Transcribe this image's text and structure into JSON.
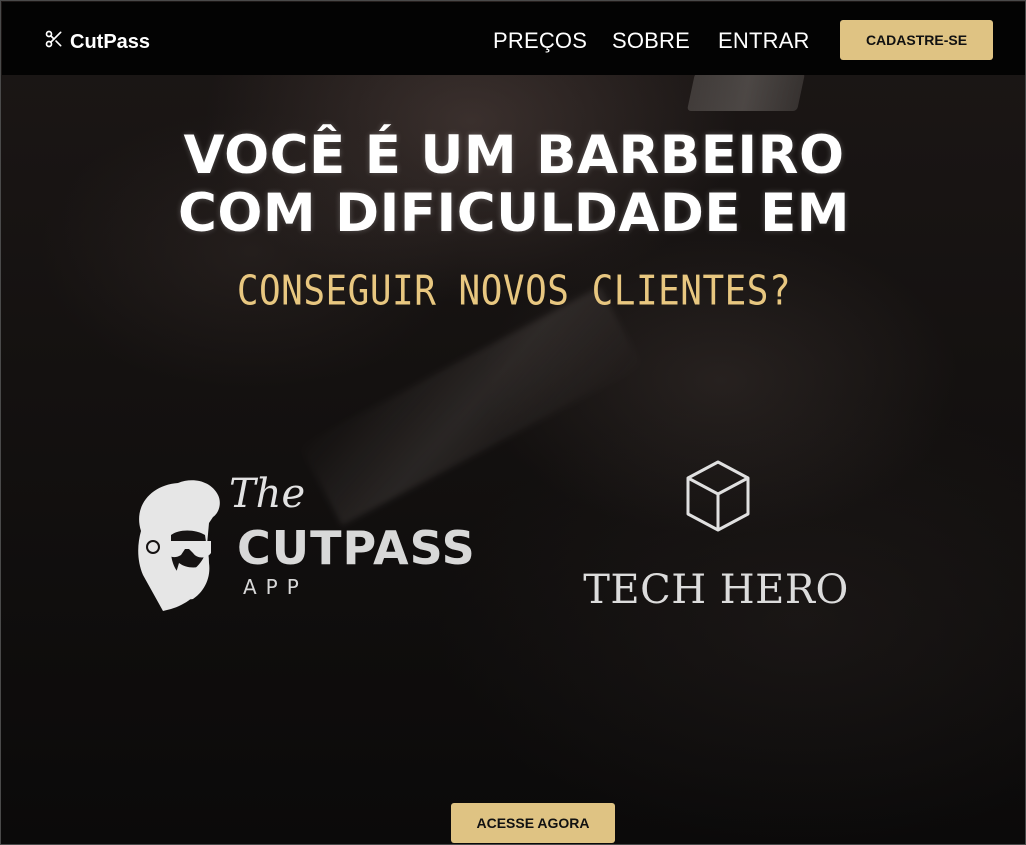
{
  "header": {
    "brand_name": "CutPass",
    "brand_icon": "scissors-icon",
    "nav": {
      "pricing": "PREÇOS",
      "about": "SOBRE",
      "login": "ENTRAR"
    },
    "signup_label": "CADASTRE-SE"
  },
  "hero": {
    "title_line1": "VOCÊ É UM BARBEIRO",
    "title_line2": "COM DIFICULDADE EM",
    "subtitle": "CONSEGUIR NOVOS CLIENTES?"
  },
  "logos": {
    "cutpass": {
      "the": "The",
      "name": "CUTPASS",
      "app": "APP"
    },
    "techhero": {
      "icon": "cube-icon",
      "name": "TECH HERO"
    }
  },
  "cta": {
    "access_label": "ACESSE AGORA"
  },
  "colors": {
    "accent": "#dfc383",
    "subtitle": "#e8c780",
    "header_bg": "#030303"
  }
}
